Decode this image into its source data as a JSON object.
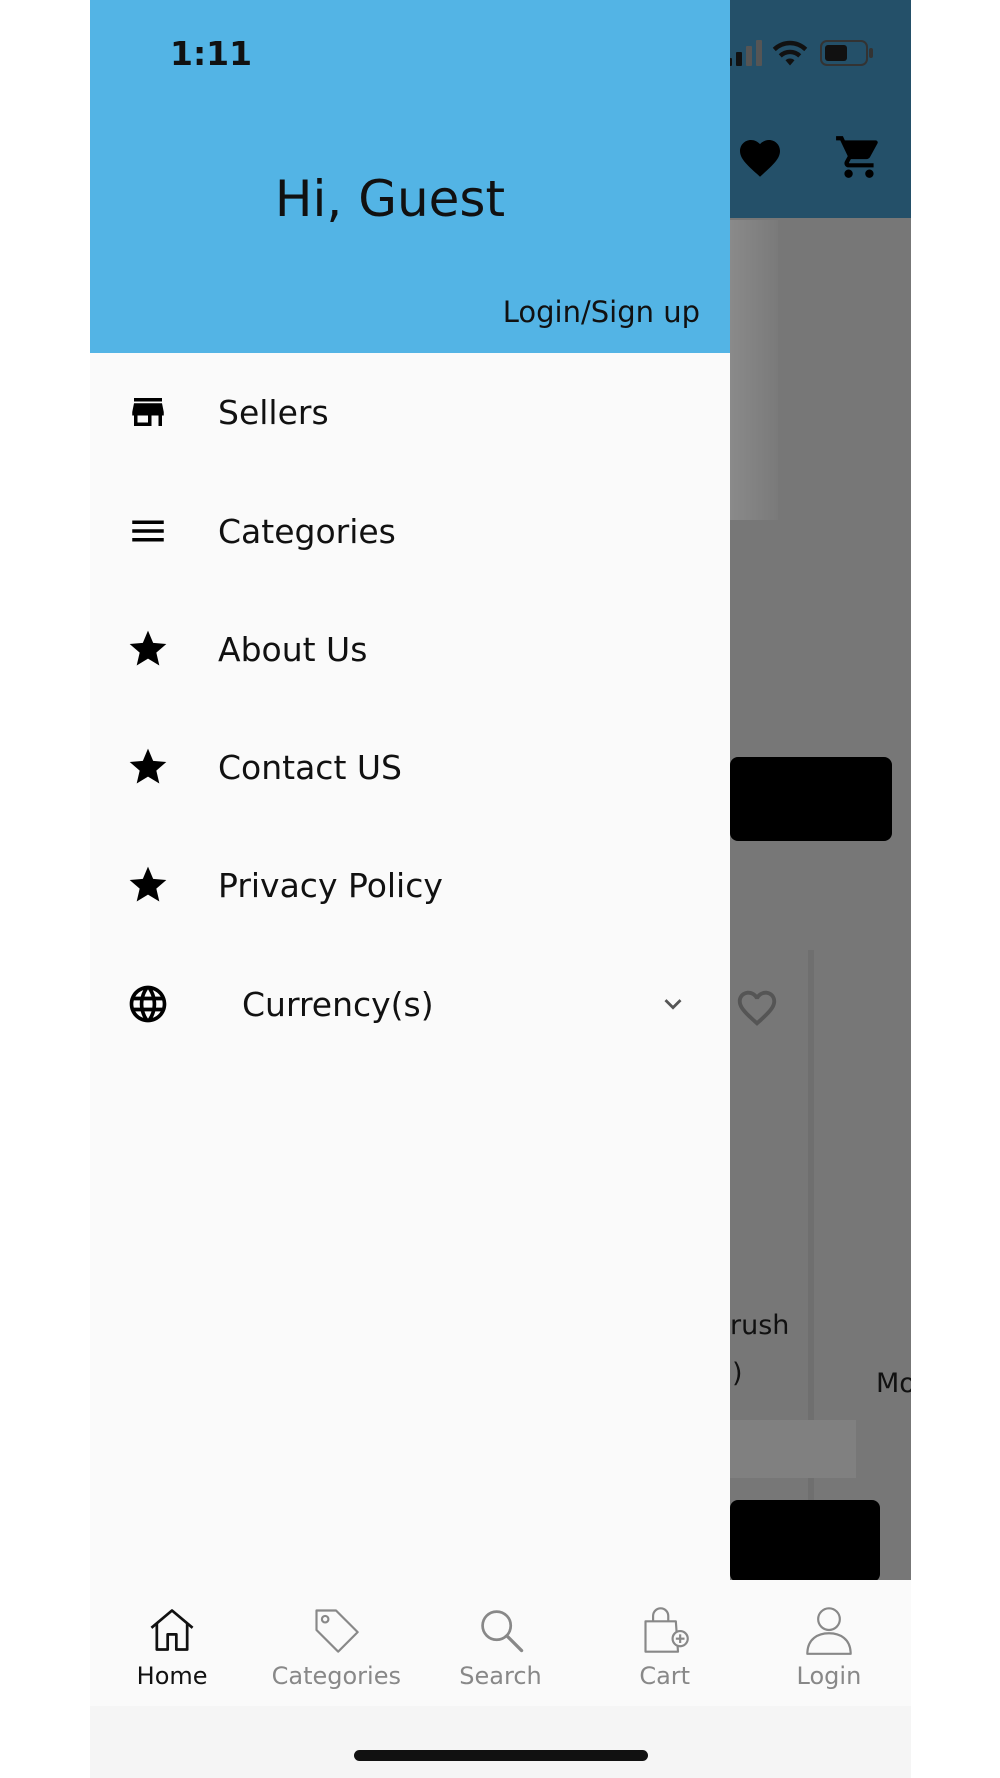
{
  "status_bar": {
    "time": "1:11"
  },
  "drawer": {
    "greeting": "Hi, Guest",
    "login_link": "Login/Sign up",
    "items": [
      {
        "label": "Sellers",
        "icon": "store-icon"
      },
      {
        "label": "Categories",
        "icon": "menu-lines-icon"
      },
      {
        "label": "About Us",
        "icon": "star-icon"
      },
      {
        "label": "Contact US",
        "icon": "star-icon"
      },
      {
        "label": "Privacy Policy",
        "icon": "star-icon"
      },
      {
        "label": "Currency(s)",
        "icon": "globe-icon",
        "expandable": true
      }
    ]
  },
  "background_app": {
    "partial_texts": [
      "rush",
      ")",
      "Mo"
    ]
  },
  "tabbar": {
    "tabs": [
      {
        "label": "Home",
        "icon": "home-icon",
        "active": true
      },
      {
        "label": "Categories",
        "icon": "tag-icon",
        "active": false
      },
      {
        "label": "Search",
        "icon": "search-icon",
        "active": false
      },
      {
        "label": "Cart",
        "icon": "shopping-bag-icon",
        "active": false
      },
      {
        "label": "Login",
        "icon": "user-icon",
        "active": false
      }
    ]
  },
  "colors": {
    "drawer_header": "#53b4e5",
    "app_topbar": "#245069",
    "overlay": "#777777",
    "drawer_bg": "#fafafa"
  }
}
